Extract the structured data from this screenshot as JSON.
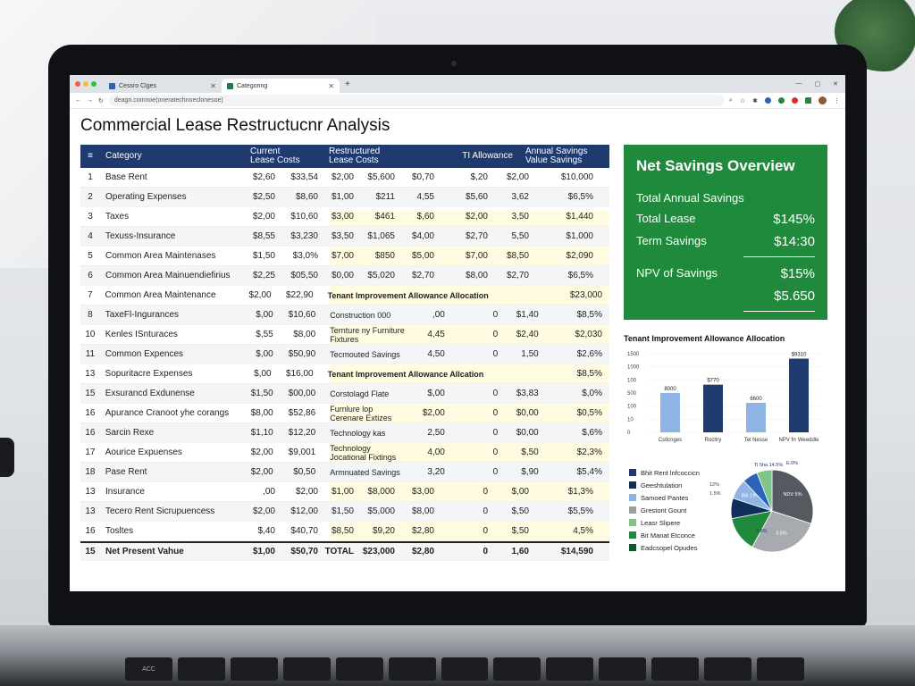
{
  "browser": {
    "tabs": [
      {
        "label": "Cessro Clges",
        "active": false
      },
      {
        "label": "Categoring",
        "active": true
      }
    ],
    "url": "deagn.comnoe(oneratechnoeclonesoe)"
  },
  "page": {
    "title": "Commercial Lease  Restructucnr Analysis"
  },
  "table": {
    "headers": {
      "menu": "≡",
      "category": "Category",
      "current_1": "Current",
      "current_2": "Lease Costs",
      "restructured_1": "Restructured",
      "restructured_2": "Lease Costs",
      "ti": "TI Allowance",
      "annual_1": "Annual Savings",
      "annual_2": "Value Savings"
    },
    "rows": [
      {
        "n": "1",
        "cat": "Base Rent",
        "a": "$2,60",
        "b": "$33,54",
        "c": "$2,00",
        "d": "$5,600",
        "e": "$0,70",
        "f": "$,20",
        "g": "$2,00",
        "h": "$10,000"
      },
      {
        "n": "2",
        "cat": "Operating Expenses",
        "a": "$2,50",
        "b": "$8,60",
        "c": "$1,00",
        "d": "$211",
        "e": "4,55",
        "f": "$5,60",
        "g": "3,62",
        "h": "$6,5%"
      },
      {
        "n": "3",
        "cat": "Taxes",
        "a": "$2,00",
        "b": "$10,60",
        "c": "$3,00",
        "d": "$461",
        "e": "$,60",
        "f": "$2,00",
        "g": "3,50",
        "h": "$1,440"
      },
      {
        "n": "4",
        "cat": "Texuss-Insurance",
        "a": "$8,55",
        "b": "$3,230",
        "c": "$3,50",
        "d": "$1,065",
        "e": "$4,00",
        "f": "$2,70",
        "g": "5,50",
        "h": "$1,000"
      },
      {
        "n": "5",
        "cat": "Common Area Maintenases",
        "a": "$1,50",
        "b": "$3,0%",
        "c": "$7,00",
        "d": "$850",
        "e": "$5,00",
        "f": "$7,00",
        "g": "$8,50",
        "h": "$2,090"
      },
      {
        "n": "6",
        "cat": "Common Area Mainuendiefirius",
        "a": "$2,25",
        "b": "$05,50",
        "c": "$0,00",
        "d": "$5,020",
        "e": "$2,70",
        "f": "$8,00",
        "g": "$2,70",
        "h": "$6,5%"
      },
      {
        "n": "7",
        "cat": "Common Area Maintenance",
        "a": "$2,00",
        "b": "$22,90",
        "alloc": "Tenant Improvement Allowance Allocation",
        "h": "$23,000"
      },
      {
        "n": "8",
        "cat": "TaxeFl-Ingurances",
        "a": "$,00",
        "b": "$10,60",
        "c": "Construction 000",
        "e": ",00",
        "f": "0",
        "g": "$1,40",
        "h": "$8,5%"
      },
      {
        "n": "10",
        "cat": "Kenles ISnturaces",
        "a": "$,55",
        "b": "$8,00",
        "c": "Ternture ny Furniture Fixtures",
        "e": "4,45",
        "f": "0",
        "g": "$2,40",
        "h": "$2,030"
      },
      {
        "n": "11",
        "cat": "Common Expences",
        "a": "$,00",
        "b": "$50,90",
        "c": "Tecmouted Savings",
        "e": "4,50",
        "f": "0",
        "g": "1,50",
        "h": "$2,6%"
      },
      {
        "n": "13",
        "cat": "Sopuritacre Expenses",
        "a": "$,00",
        "b": "$16,00",
        "alloc": "Tenant Improvement Allowance Allcation",
        "h": "$8,5%"
      },
      {
        "n": "15",
        "cat": "Exsuranc⁠d Exdunense",
        "a": "$1,50",
        "b": "$00,00",
        "c": "Corstolagd Flate",
        "e": "$,00",
        "f": "0",
        "g": "$3,83",
        "h": "$,0%"
      },
      {
        "n": "16",
        "cat": "Apurance Cranoot yhe corangs",
        "a": "$8,00",
        "b": "$52,86",
        "c": "Furnlure lop Cerenare Extizes",
        "e": "$2,00",
        "f": "0",
        "g": "$0,00",
        "h": "$0,5%"
      },
      {
        "n": "16",
        "cat": "Sarcin Rexe",
        "a": "$1,10",
        "b": "$12,20",
        "c": "Technology kas",
        "e": "2,50",
        "f": "0",
        "g": "$0,00",
        "h": "$,6%"
      },
      {
        "n": "17",
        "cat": "Aourice Expuenses",
        "a": "$2,00",
        "b": "$9,001",
        "c": "Technology Jocational Fixtings",
        "e": "4,00",
        "f": "0",
        "g": "$,50",
        "h": "$2,3%"
      },
      {
        "n": "18",
        "cat": "Pase Rent",
        "a": "$2,00",
        "b": "$0,50",
        "c": "Armnuated Savings",
        "e": "3,20",
        "f": "0",
        "g": "$,90",
        "h": "$5,4%"
      },
      {
        "n": "13",
        "cat": "Insurance",
        "a": ",00",
        "b": "$2,00",
        "c": "$1,00",
        "d": "$8,000",
        "e": "$3,00",
        "f": "0",
        "g": "$,00",
        "h": "$1,3%"
      },
      {
        "n": "13",
        "cat": "Tecero Rent Sicrupuencess",
        "a": "$2,00",
        "b": "$12,00",
        "c": "$1,50",
        "d": "$5,000",
        "e": "$8,00",
        "f": "0",
        "g": "$,50",
        "h": "$5,5%"
      },
      {
        "n": "16",
        "cat": "Tosltes",
        "a": "$,40",
        "b": "$40,70",
        "c": "$8,50",
        "d": "$9,20",
        "e": "$2,80",
        "f": "0",
        "g": "$,50",
        "h": "4,5%"
      },
      {
        "n": "15",
        "cat": "Net Present Vahue",
        "a": "$1,00",
        "b": "$50,70",
        "c": "TOTAL",
        "d": "$23,000",
        "e": "$2,80",
        "f": "0",
        "g": "1,60",
        "h": "$14,590",
        "total": true
      }
    ]
  },
  "summary": {
    "title": "Net Savings Overview",
    "lines": [
      {
        "label": "Total Annual Savings",
        "value": ""
      },
      {
        "label": "Total Lease",
        "value": "$145%"
      },
      {
        "label": "Term Savings",
        "value": "$14:30"
      },
      {
        "label": "NPV of Savings",
        "value": "$15%"
      },
      {
        "label": "",
        "value": "$5.650"
      }
    ]
  },
  "chart_data": [
    {
      "type": "bar",
      "title": "Tenant Improvement Allowance Allocation",
      "categories": [
        "Cstlcnges",
        "Rocltry",
        "Tel Nesse",
        "NPV frr Weeddle"
      ],
      "series": [
        {
          "values": [
            800,
            970,
            600,
            1500
          ],
          "colors": [
            "#8fb5e6",
            "#1e3a6e",
            "#8fb5e6",
            "#1e3a6e"
          ]
        }
      ],
      "data_labels": [
        "8000",
        "$770",
        "6600",
        "$9310"
      ],
      "yticks": [
        "1500",
        "1000",
        "100",
        "500",
        "100",
        "10",
        "0"
      ],
      "ylim": [
        0,
        1600
      ]
    },
    {
      "type": "pie",
      "legend": [
        {
          "label": "Bhit Rent lnfcoccicn",
          "color": "#1e3a6e"
        },
        {
          "label": "Geeshtulation",
          "color": "#0f2f5a"
        },
        {
          "label": "Samoed Pantes",
          "color": "#8fb5e6"
        },
        {
          "label": "Grestont Gount",
          "color": "#9aa0a6"
        },
        {
          "label": "Leasr Slipere",
          "color": "#7fc48a"
        },
        {
          "label": "Bit Manat Etconce",
          "color": "#1f8a3b"
        },
        {
          "label": "Eadcsopel Opudes",
          "color": "#0f5a2a"
        }
      ],
      "slices": [
        {
          "label": "NDV 5%",
          "value": 30,
          "color": "#555a60"
        },
        {
          "label": "3.5%",
          "value": 28,
          "color": "#a7abb0"
        },
        {
          "label": "",
          "value": 14,
          "color": "#1f8a3b"
        },
        {
          "label": "",
          "value": 8,
          "color": "#0f2f5a"
        },
        {
          "label": "Bilr 19%",
          "value": 8,
          "color": "#8fb5e6"
        },
        {
          "label": "",
          "value": 6,
          "color": "#2a63b8"
        },
        {
          "label": "",
          "value": 6,
          "color": "#7fc48a"
        }
      ],
      "outer_labels": [
        "Ti 5ha 14.5%",
        "E.0%",
        "12%",
        "1.5%",
        "3.8%"
      ]
    }
  ],
  "keyboard": {
    "keys": [
      "ACC",
      "",
      "",
      "",
      "",
      "",
      "",
      "",
      "",
      "",
      "",
      "",
      ""
    ]
  }
}
